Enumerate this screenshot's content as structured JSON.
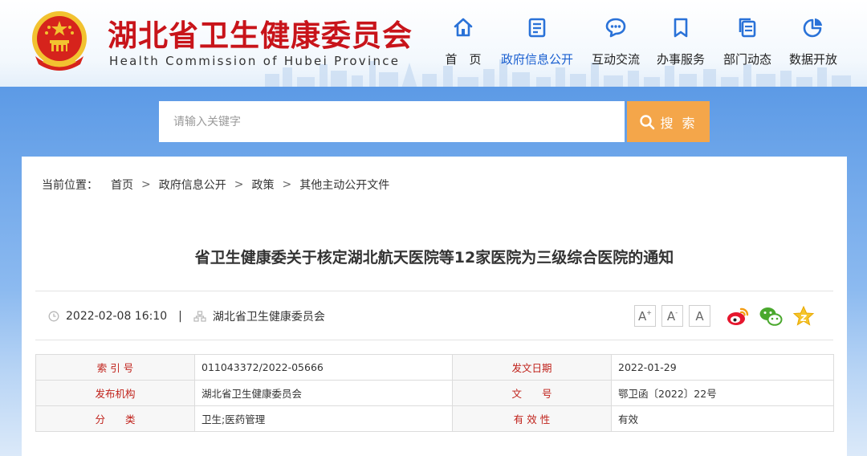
{
  "header": {
    "title_cn": "湖北省卫生健康委员会",
    "title_en": "Health Commission of Hubei Province",
    "emblem_icon": "national-emblem-icon",
    "colors": {
      "brand_red": "#c8141a",
      "nav_icon_blue": "#2a72d8",
      "active_nav": "#1a5fd0"
    }
  },
  "nav": [
    {
      "label": "首　页",
      "icon": "home-icon",
      "active": false
    },
    {
      "label": "政府信息公开",
      "icon": "document-list-icon",
      "active": true
    },
    {
      "label": "互动交流",
      "icon": "chat-bubble-icon",
      "active": false
    },
    {
      "label": "办事服务",
      "icon": "bookmark-icon",
      "active": false
    },
    {
      "label": "部门动态",
      "icon": "copy-document-icon",
      "active": false
    },
    {
      "label": "数据开放",
      "icon": "pie-chart-icon",
      "active": false
    }
  ],
  "search": {
    "placeholder": "请输入关键字",
    "button_label": "搜 索",
    "button_icon": "search-icon",
    "button_color": "#f4a64a"
  },
  "breadcrumb": {
    "lead": "当前位置：",
    "items": [
      "首页",
      "政府信息公开",
      "政策",
      "其他主动公开文件"
    ],
    "separator": ">"
  },
  "article": {
    "title": "省卫生健康委关于核定湖北航天医院等12家医院为三级综合医院的通知",
    "datetime": "2022-02-08 16:10",
    "source": "湖北省卫生健康委员会",
    "meta_separator": "|",
    "font_controls": [
      {
        "label": "A",
        "sup": "+",
        "name": "font-increase-button"
      },
      {
        "label": "A",
        "sup": "-",
        "name": "font-decrease-button"
      },
      {
        "label": "A",
        "sup": "",
        "name": "font-reset-button"
      }
    ],
    "share_icons": [
      "weibo-icon",
      "wechat-icon",
      "favorite-star-icon"
    ]
  },
  "info_table": {
    "rows": [
      [
        {
          "key": "索 引 号",
          "value": "011043372/2022-05666"
        },
        {
          "key": "发文日期",
          "value": "2022-01-29"
        }
      ],
      [
        {
          "key": "发布机构",
          "value": "湖北省卫生健康委员会"
        },
        {
          "key": "文　　号",
          "value": "鄂卫函〔2022〕22号"
        }
      ],
      [
        {
          "key": "分　　类",
          "value": "卫生;医药管理"
        },
        {
          "key": "有 效 性",
          "value": "有效"
        }
      ]
    ]
  }
}
